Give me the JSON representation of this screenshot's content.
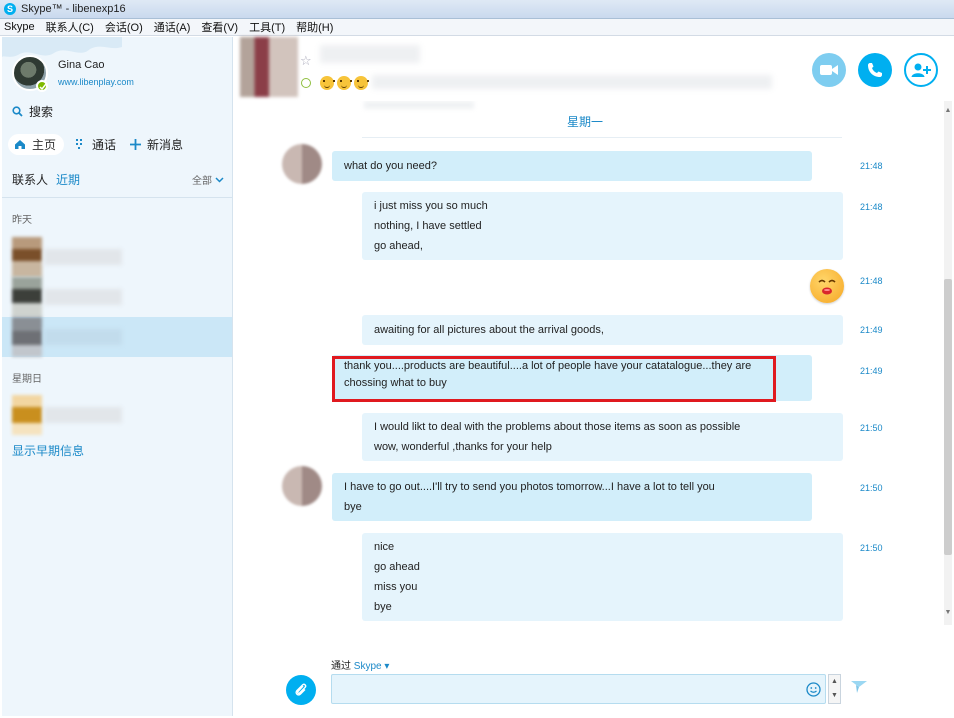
{
  "window": {
    "title": "Skype™ - libenexp16"
  },
  "menu": [
    "Skype",
    "联系人(C)",
    "会话(O)",
    "通话(A)",
    "查看(V)",
    "工具(T)",
    "帮助(H)"
  ],
  "profile": {
    "name": "Gina Cao",
    "website": "www.libenplay.com"
  },
  "sidebar": {
    "search_label": "搜索",
    "nav": {
      "home": "主页",
      "calls": "通话",
      "new_message": "新消息"
    },
    "tabs": {
      "contacts": "联系人",
      "recent": "近期",
      "filter": "全部"
    },
    "groups": {
      "yesterday": "昨天",
      "sunday": "星期日"
    },
    "show_earlier": "显示早期信息"
  },
  "conversation": {
    "day_label": "星期一",
    "messages": [
      {
        "lines": [
          "what do you need?"
        ],
        "time": "21:48"
      },
      {
        "lines": [
          "i just miss you so much",
          "nothing, I have settled",
          "go ahead,"
        ],
        "time": "21:48"
      },
      {
        "lines": [],
        "time": "21:48",
        "emoji": "kiss-emoji"
      },
      {
        "lines": [
          "awaiting for all pictures about the arrival goods,"
        ],
        "time": "21:49"
      },
      {
        "lines": [
          "thank you....products are beautiful....a lot of people have your catatalogue...they are",
          "chossing what to buy"
        ],
        "time": "21:49"
      },
      {
        "lines": [
          "I would likt to deal with the problems about those items as soon as possible",
          "wow, wonderful ,thanks for your help"
        ],
        "time": "21:50"
      },
      {
        "lines": [
          "I have to go out....I'll try to send you photos tomorrow...I have a lot to tell you",
          "bye"
        ],
        "time": "21:50"
      },
      {
        "lines": [
          "nice",
          "go ahead",
          "miss you",
          "bye"
        ],
        "time": "21:50"
      }
    ]
  },
  "composer": {
    "via_label": "通过",
    "via_service": "Skype",
    "message": ""
  },
  "colors": {
    "accent": "#00aff0",
    "link": "#1b89c8",
    "incoming_bubble": "#d2eefa",
    "outgoing_bubble": "#e5f4fc",
    "highlight": "#e0191f"
  }
}
